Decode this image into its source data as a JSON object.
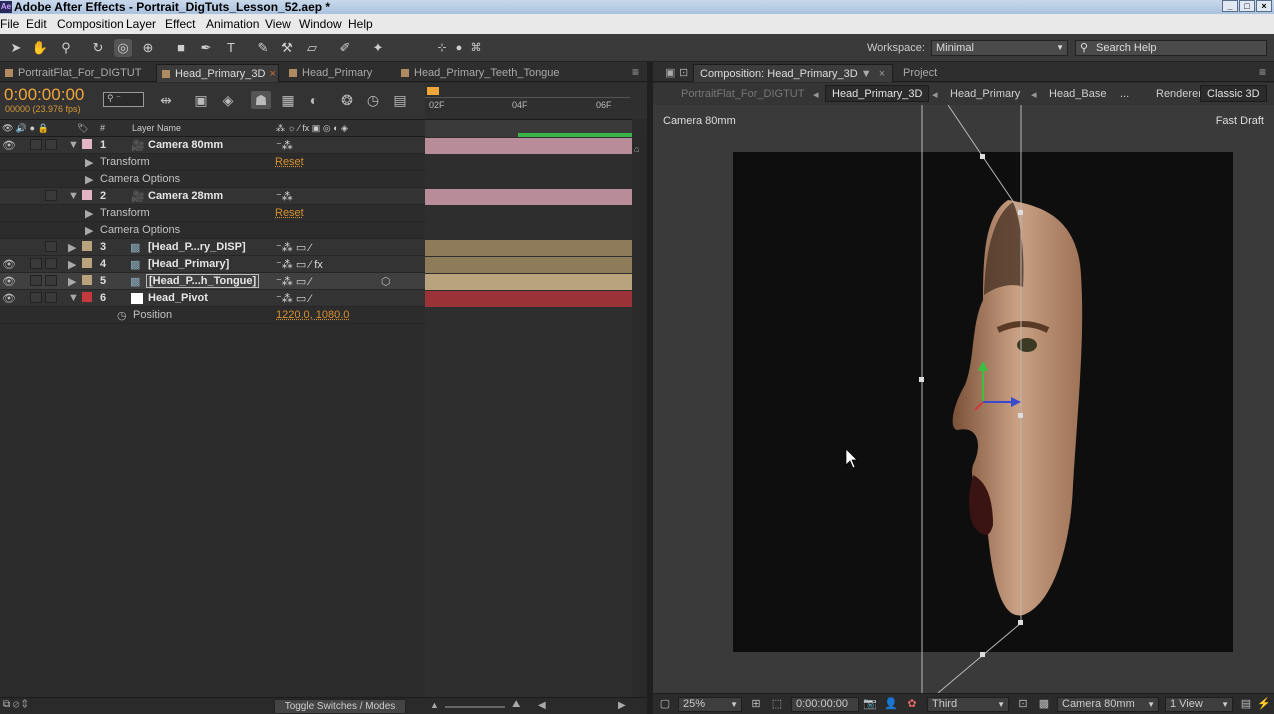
{
  "window": {
    "title": "Adobe After Effects - Portrait_DigTuts_Lesson_52.aep *",
    "logo": "Ae"
  },
  "menu": [
    "File",
    "Edit",
    "Composition",
    "Layer",
    "Effect",
    "Animation",
    "View",
    "Window",
    "Help"
  ],
  "workspace": {
    "label": "Workspace:",
    "value": "Minimal"
  },
  "search": {
    "placeholder": "Search Help"
  },
  "timeline_tabs": [
    "PortraitFlat_For_DIGTUT",
    "Head_Primary_3D",
    "Head_Primary",
    "Head_Primary_Teeth_Tongue"
  ],
  "timeline": {
    "timecode": "0:00:00:00",
    "fps": "00000 (23.976 fps)",
    "ruler": [
      "02F",
      "04F",
      "06F"
    ],
    "col_hash": "#",
    "col_layer_name": "Layer Name",
    "toggle_label": "Toggle Switches / Modes"
  },
  "layers": [
    {
      "num": "1",
      "name": "Camera 80mm",
      "color": "#e3b5c4",
      "props": [
        {
          "name": "Transform",
          "value": "Reset"
        },
        {
          "name": "Camera Options",
          "value": ""
        }
      ]
    },
    {
      "num": "2",
      "name": "Camera 28mm",
      "color": "#e3b5c4",
      "props": [
        {
          "name": "Transform",
          "value": "Reset"
        },
        {
          "name": "Camera Options",
          "value": ""
        }
      ]
    },
    {
      "num": "3",
      "name": "[Head_P...ry_DISP]",
      "color": "#b9a37d"
    },
    {
      "num": "4",
      "name": "[Head_Primary]",
      "color": "#b9a37d"
    },
    {
      "num": "5",
      "name": "[Head_P...h_Tongue]",
      "color": "#b9a37d"
    },
    {
      "num": "6",
      "name": "Head_Pivot",
      "color": "#c3393d",
      "props": [
        {
          "name": "Position",
          "value": "1220.0, 1080.0"
        }
      ]
    }
  ],
  "comp_panel": {
    "tab": "Composition: Head_Primary_3D",
    "tab2": "Project",
    "crumbs": [
      "PortraitFlat_For_DIGTUT",
      "Head_Primary_3D",
      "Head_Primary",
      "Head_Base",
      "..."
    ],
    "renderer_label": "Renderer:",
    "renderer": "Classic 3D",
    "camera_label": "Camera 80mm",
    "draft": "Fast Draft"
  },
  "viewer_bar": {
    "zoom": "25%",
    "time": "0:00:00:00",
    "resolution": "Third",
    "camera": "Camera 80mm",
    "views": "1 View"
  },
  "colors": {
    "accent": "#f1a63a",
    "track_camera": "#b98c99",
    "track_footage": "#8d7b5a",
    "track_pivot": "#9a3237",
    "workarea": "#3ab54a"
  }
}
